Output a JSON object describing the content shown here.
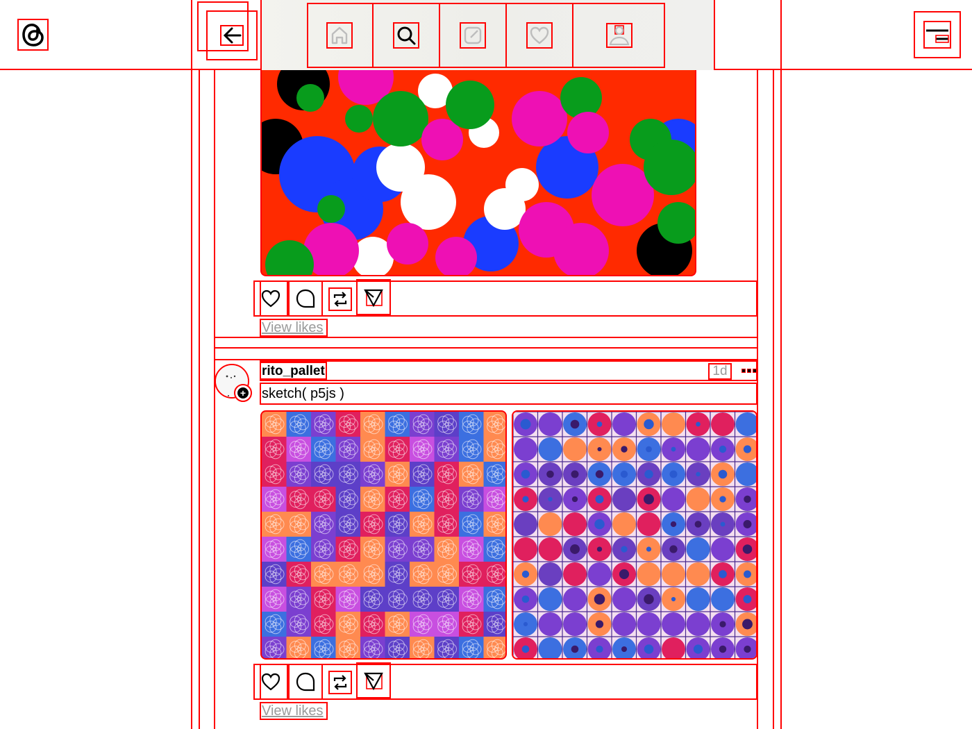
{
  "header": {
    "logo_icon": "threads-logo-icon",
    "back_icon": "back-arrow-icon",
    "nav": [
      {
        "name": "home",
        "icon": "home-icon"
      },
      {
        "name": "search",
        "icon": "search-icon"
      },
      {
        "name": "compose",
        "icon": "compose-icon"
      },
      {
        "name": "activity",
        "icon": "heart-icon"
      },
      {
        "name": "profile",
        "icon": "profile-icon"
      }
    ],
    "menu_icon": "menu-icon"
  },
  "posts": [
    {
      "image_icons": [
        "like",
        "reply",
        "repost",
        "share"
      ],
      "view_likes": "View likes"
    },
    {
      "username": "rito_pallet",
      "time": "1d",
      "caption": "sketch( p5js )",
      "view_likes": "View likes"
    }
  ],
  "colors": {
    "guide": "#ff0000",
    "muted_text": "#9a9a9a",
    "art_red": "#ff2a00",
    "art_blue": "#1a3cff",
    "art_green": "#089c1c",
    "art_pink": "#ee10b4"
  }
}
